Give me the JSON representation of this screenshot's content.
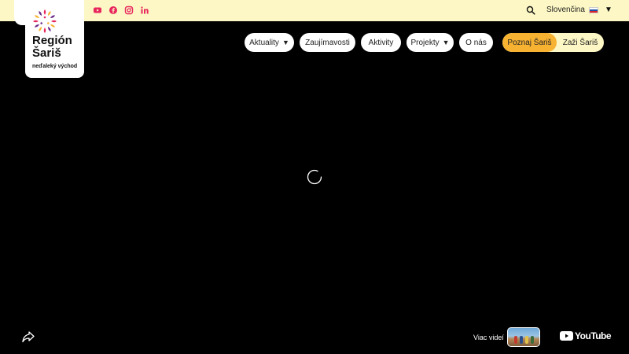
{
  "header": {
    "social": [
      {
        "name": "youtube",
        "color": "#e8265e"
      },
      {
        "name": "facebook",
        "color": "#e8265e"
      },
      {
        "name": "instagram",
        "color": "#e8265e"
      },
      {
        "name": "linkedin",
        "color": "#e8265e"
      }
    ],
    "language": "Slovenčina"
  },
  "logo": {
    "title_line1": "Región",
    "title_line2": "Šariš",
    "subtitle": "neďaleký východ"
  },
  "nav": {
    "items": [
      {
        "label": "Aktuality",
        "dropdown": true
      },
      {
        "label": "Zaujímavosti",
        "dropdown": false
      },
      {
        "label": "Aktivity",
        "dropdown": false
      },
      {
        "label": "Projekty",
        "dropdown": true
      },
      {
        "label": "O nás",
        "dropdown": false
      }
    ],
    "switch": [
      {
        "label": "Poznaj Šariš",
        "active": true
      },
      {
        "label": "Zaži Šariš",
        "active": false
      }
    ],
    "accent": "#f7b232"
  },
  "video": {
    "more_videos": "Viac videí",
    "youtube": "YouTube"
  }
}
